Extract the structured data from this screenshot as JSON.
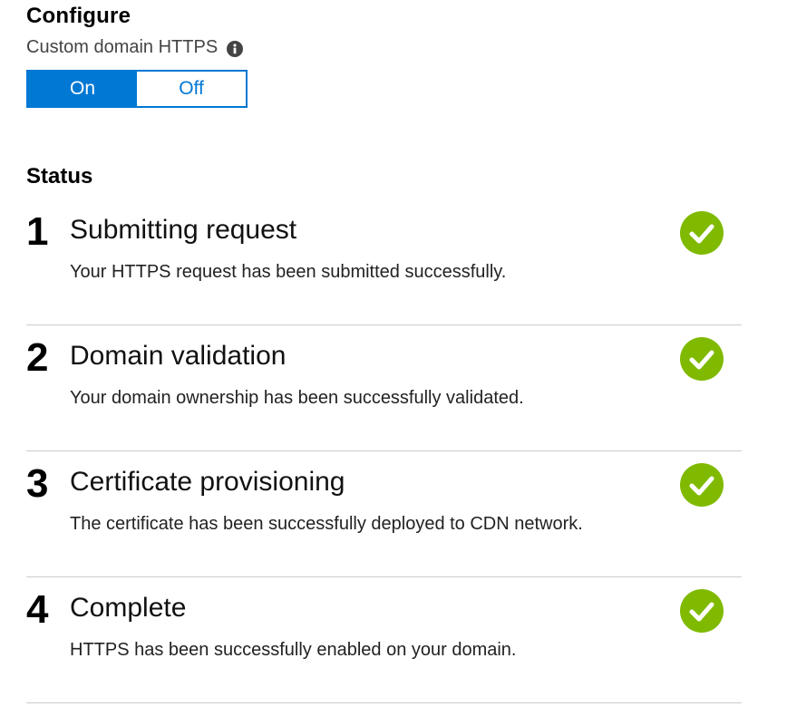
{
  "configure": {
    "title": "Configure",
    "setting_label": "Custom domain HTTPS",
    "info_icon": "info-icon",
    "toggle": {
      "on_label": "On",
      "off_label": "Off",
      "selected": "On"
    }
  },
  "status": {
    "title": "Status",
    "steps": [
      {
        "number": "1",
        "title": "Submitting request",
        "description": "Your HTTPS request has been submitted successfully.",
        "icon": "check-icon"
      },
      {
        "number": "2",
        "title": "Domain validation",
        "description": "Your domain ownership has been successfully validated.",
        "icon": "check-icon"
      },
      {
        "number": "3",
        "title": "Certificate provisioning",
        "description": "The certificate has been successfully deployed to CDN network.",
        "icon": "check-icon"
      },
      {
        "number": "4",
        "title": "Complete",
        "description": "HTTPS has been successfully enabled on your domain.",
        "icon": "check-icon"
      }
    ]
  },
  "colors": {
    "accent": "#0078d4",
    "success": "#7fba00",
    "divider": "#cccccc"
  }
}
